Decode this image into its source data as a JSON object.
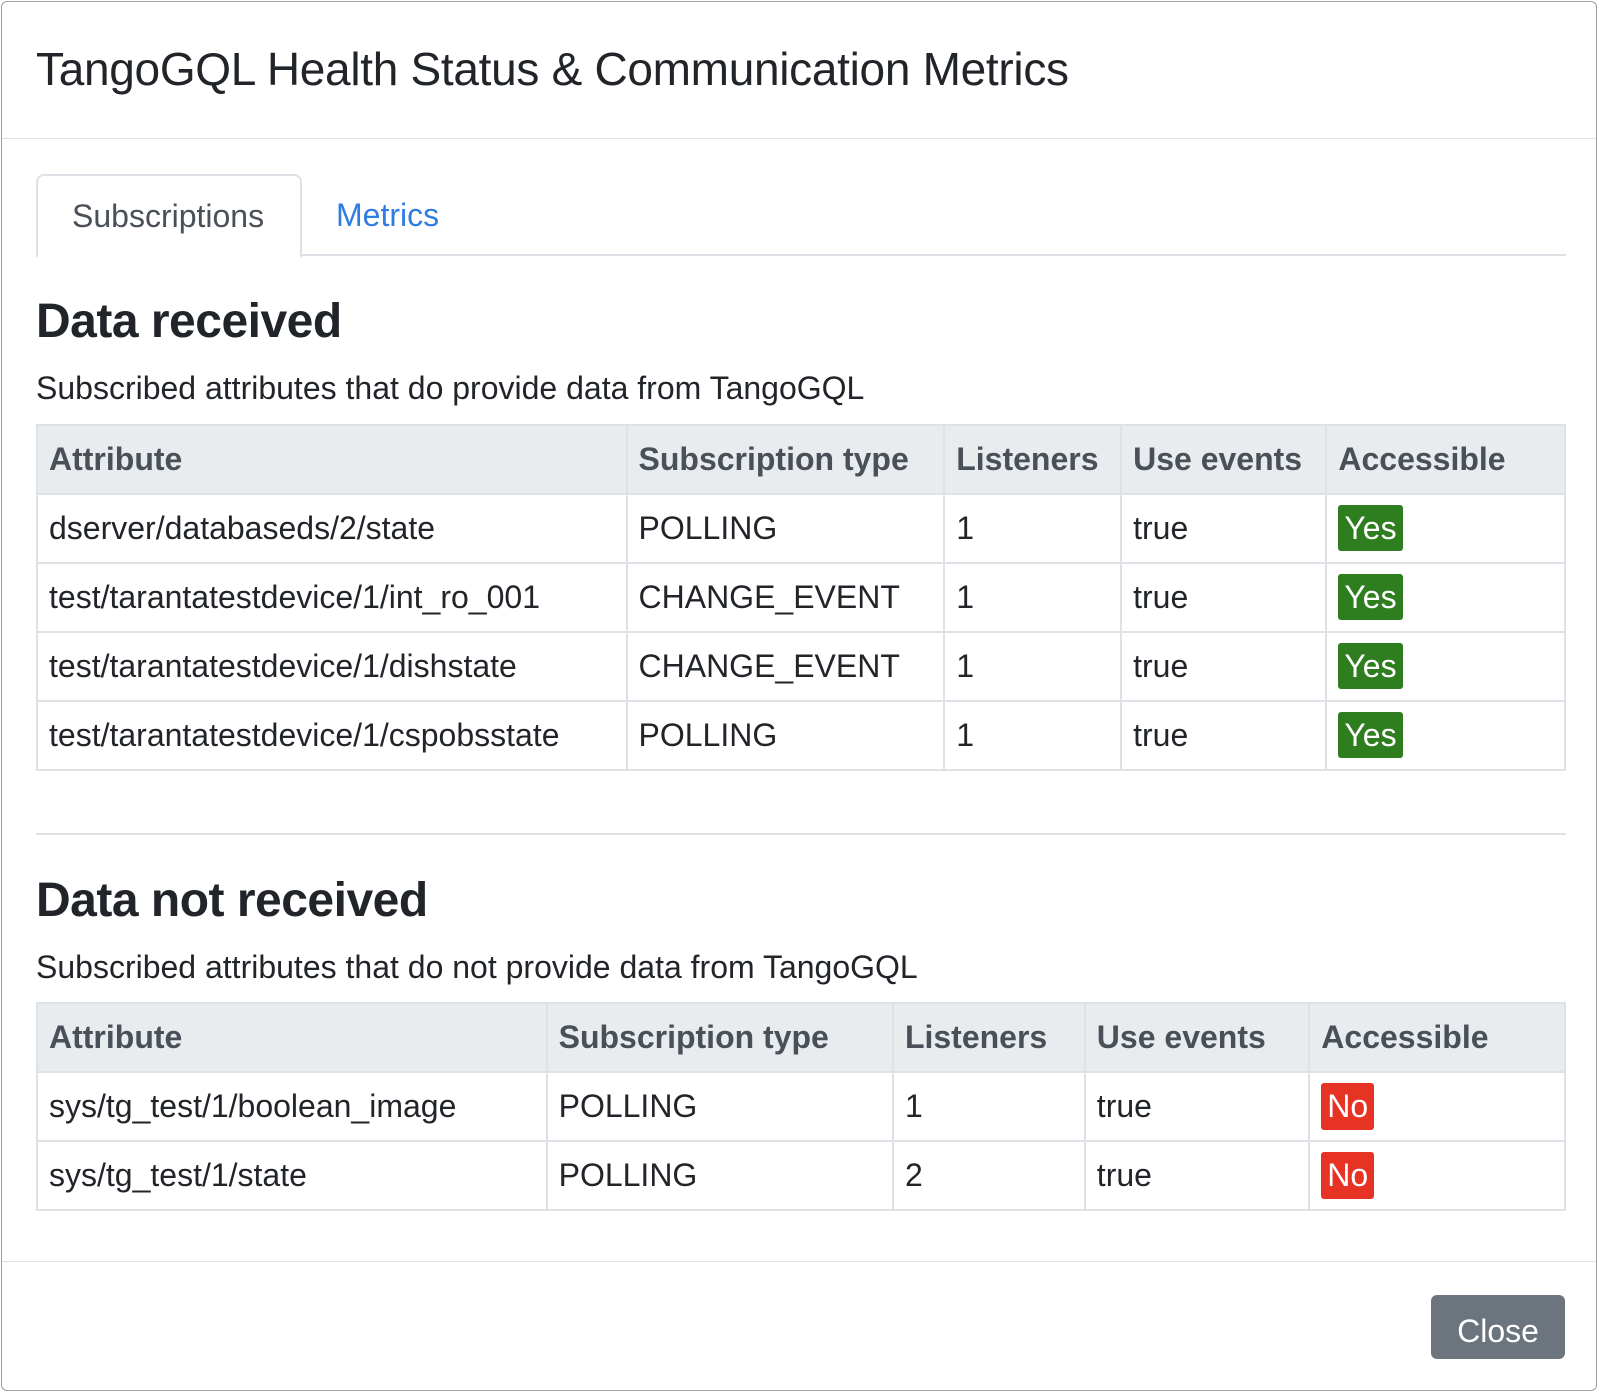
{
  "dialog": {
    "title": "TangoGQL Health Status & Communication Metrics",
    "close_label": "Close"
  },
  "tabs": [
    {
      "label": "Subscriptions",
      "active": true
    },
    {
      "label": "Metrics",
      "active": false
    }
  ],
  "columns": [
    "Attribute",
    "Subscription type",
    "Listeners",
    "Use events",
    "Accessible"
  ],
  "received": {
    "title": "Data received",
    "subtitle": "Subscribed attributes that do provide data from TangoGQL",
    "rows": [
      {
        "attribute": "dserver/databaseds/2/state",
        "type": "POLLING",
        "listeners": "1",
        "use_events": "true",
        "accessible": "Yes"
      },
      {
        "attribute": "test/tarantatestdevice/1/int_ro_001",
        "type": "CHANGE_EVENT",
        "listeners": "1",
        "use_events": "true",
        "accessible": "Yes"
      },
      {
        "attribute": "test/tarantatestdevice/1/dishstate",
        "type": "CHANGE_EVENT",
        "listeners": "1",
        "use_events": "true",
        "accessible": "Yes"
      },
      {
        "attribute": "test/tarantatestdevice/1/cspobsstate",
        "type": "POLLING",
        "listeners": "1",
        "use_events": "true",
        "accessible": "Yes"
      }
    ]
  },
  "not_received": {
    "title": "Data not received",
    "subtitle": "Subscribed attributes that do not provide data from TangoGQL",
    "rows": [
      {
        "attribute": "sys/tg_test/1/boolean_image",
        "type": "POLLING",
        "listeners": "1",
        "use_events": "true",
        "accessible": "No"
      },
      {
        "attribute": "sys/tg_test/1/state",
        "type": "POLLING",
        "listeners": "2",
        "use_events": "true",
        "accessible": "No"
      }
    ]
  },
  "colors": {
    "badge_yes": "#2e7d1f",
    "badge_no": "#e63323",
    "tab_link": "#2f7de1",
    "close_button": "#6c757d"
  }
}
